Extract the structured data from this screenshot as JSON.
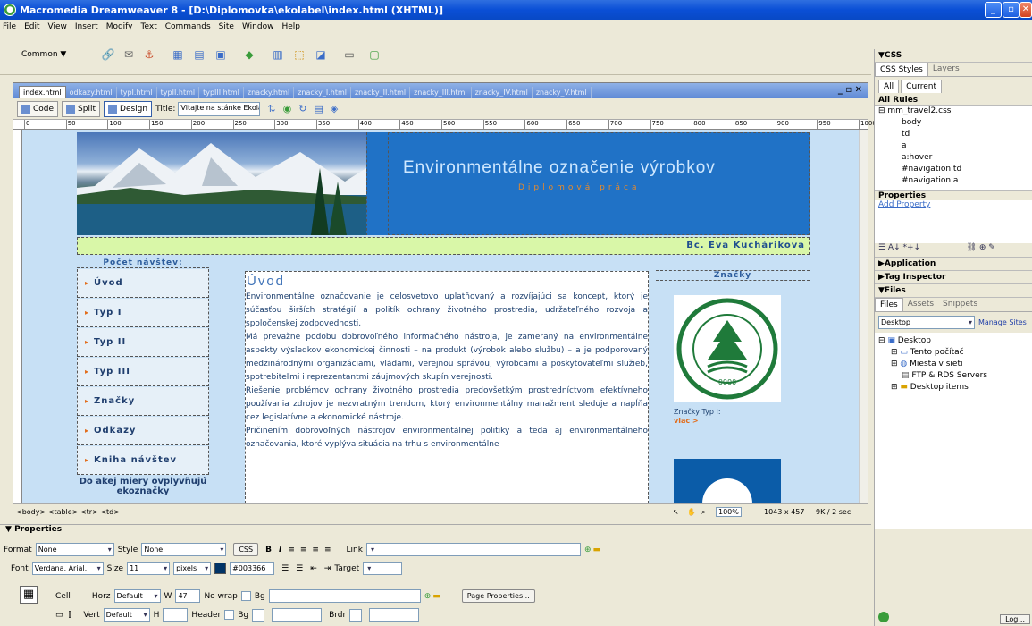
{
  "window": {
    "title": "Macromedia Dreamweaver 8 - [D:\\Diplomovka\\ekolabel\\index.html (XHTML)]"
  },
  "menu": [
    "File",
    "Edit",
    "View",
    "Insert",
    "Modify",
    "Text",
    "Commands",
    "Site",
    "Window",
    "Help"
  ],
  "insert_bar": {
    "category": "Common"
  },
  "doc_tabs": [
    "index.html",
    "odkazy.html",
    "typI.html",
    "typII.html",
    "typIII.html",
    "znacky.html",
    "znacky_I.html",
    "znacky_II.html",
    "znacky_III.html",
    "znacky_IV.html",
    "znacky_V.html"
  ],
  "doc_toolbar": {
    "code": "Code",
    "split": "Split",
    "design": "Design",
    "title_label": "Title:",
    "title_value": "Vitajte na stánke Ekolabelingu"
  },
  "ruler_marks": [
    "0",
    "50",
    "100",
    "150",
    "200",
    "250",
    "300",
    "350",
    "400",
    "450",
    "500",
    "550",
    "600",
    "650",
    "700",
    "750",
    "800",
    "850",
    "900",
    "950",
    "1000"
  ],
  "page": {
    "site_title": "Environmentálne označenie výrobkov",
    "site_subtitle": "Diplomová práca",
    "author": "Bc. Eva Kuchárikova",
    "visits_label": "Počet návštev:",
    "nav": [
      "Úvod",
      "Typ I",
      "Typ II",
      "Typ III",
      "Značky",
      "Odkazy",
      "Kniha návštev"
    ],
    "nav_question": "Do akej miery ovplyvňujú ekoznačky",
    "main_heading": "Úvod",
    "paragraphs": [
      "Environmentálne označovanie je celosvetovo uplatňovaný a rozvíjajúci sa koncept, ktorý je súčasťou širších stratégií a politík ochrany životného prostredia, udržateľného rozvoja a spoločenskej zodpovednosti.",
      "Má prevažne podobu dobrovoľného informačného nástroja, je zameraný na environmentálne aspekty výsledkov ekonomickej činnosti – na produkt (výrobok alebo službu) – a je podporovaný medzinárodnými organizáciami, vládami, verejnou správou, výrobcami a poskytovateľmi služieb, spotrebiteľmi i reprezentantmi záujmových skupín verejnosti.",
      "Riešenie problémov ochrany životného prostredia predovšetkým prostredníctvom efektívneho používania zdrojov je nezvratným trendom, ktorý environmentálny manažment sleduje a napĺňa cez legislatívne a ekonomické nástroje.",
      "Pričinením dobrovoľných nástrojov environmentálnej politiky a teda aj environmentálneho označovania, ktoré vyplýva situácia na trhu s environmentálne"
    ],
    "right_heading": "Značky",
    "ecolabel_text": "ENVIRONMENTÁLNE VHODNÝ VÝROBOK",
    "ecolabel_number": "0000",
    "right_caption": "Značky Typ I:",
    "right_more": "viac >"
  },
  "status": {
    "tags": "<body> <table> <tr> <td>",
    "zoom": "100%",
    "size": "1043 x 457",
    "weight": "9K / 2 sec"
  },
  "panels": {
    "css_title": "CSS",
    "css_tabs": [
      "CSS Styles",
      "Layers"
    ],
    "mode_tabs": [
      "All",
      "Current"
    ],
    "all_rules": "All Rules",
    "rules": [
      "mm_travel2.css",
      "body",
      "td",
      "a",
      "a:hover",
      "#navigation td",
      "#navigation a"
    ],
    "properties": "Properties",
    "add_property": "Add Property",
    "application": "Application",
    "tag_inspector": "Tag Inspector",
    "files_title": "Files",
    "files_tabs": [
      "Files",
      "Assets",
      "Snippets"
    ],
    "site_select": "Desktop",
    "manage_sites": "Manage Sites",
    "tree": [
      "Desktop",
      "Tento počítač",
      "Miesta v sieti",
      "FTP & RDS Servers",
      "Desktop items"
    ],
    "log": "Log..."
  },
  "properties_panel": {
    "title": "Properties",
    "format_label": "Format",
    "format_value": "None",
    "style_label": "Style",
    "style_value": "None",
    "css_btn": "CSS",
    "link_label": "Link",
    "font_label": "Font",
    "font_value": "Verdana, Arial,",
    "size_label": "Size",
    "size_value": "11",
    "unit_value": "pixels",
    "color_value": "#003366",
    "target_label": "Target",
    "cell_label": "Cell",
    "horz_label": "Horz",
    "horz_value": "Default",
    "w_label": "W",
    "w_value": "47",
    "nowrap_label": "No wrap",
    "bg_label": "Bg",
    "page_props": "Page Properties...",
    "vert_label": "Vert",
    "vert_value": "Default",
    "h_label": "H",
    "header_label": "Header",
    "brdr_label": "Brdr"
  },
  "colors": {
    "accent": "#0a4fd6",
    "page_bg": "#c7e0f5",
    "banner_blue": "#2072c6",
    "green_bar": "#d9f7a8",
    "text_blue": "#1c3f6e",
    "orange": "#e26c1a"
  }
}
